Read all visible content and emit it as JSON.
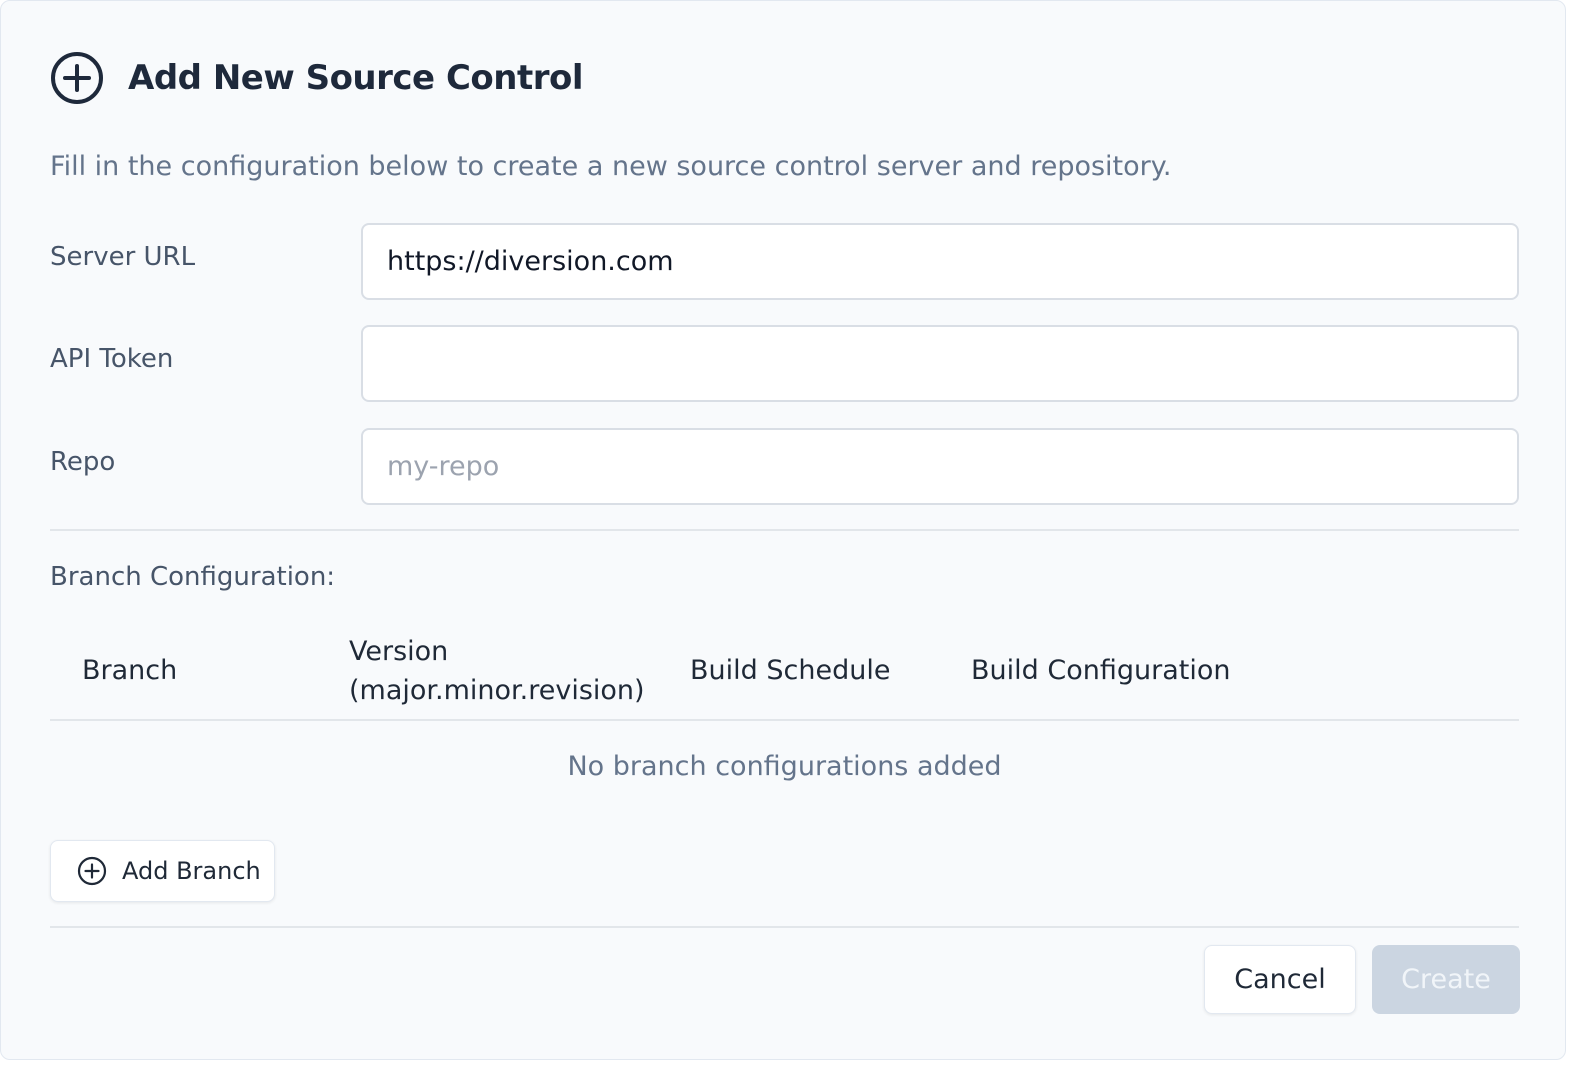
{
  "dialog": {
    "title": "Add New Source Control",
    "title_icon": "plus-circle-icon",
    "subtitle": "Fill in the configuration below to create a new source control server and repository."
  },
  "form": {
    "server_url": {
      "label": "Server URL",
      "value": "https://diversion.com",
      "placeholder": ""
    },
    "api_token": {
      "label": "API Token",
      "value": "",
      "placeholder": ""
    },
    "repo": {
      "label": "Repo",
      "value": "",
      "placeholder": "my-repo"
    }
  },
  "branches": {
    "section_label": "Branch Configuration:",
    "columns": {
      "branch": "Branch",
      "version_line1": "Version",
      "version_line2": "(major.minor.revision)",
      "build_schedule": "Build Schedule",
      "build_configuration": "Build Configuration"
    },
    "empty_message": "No branch configurations added",
    "add_button": {
      "label": "Add Branch",
      "icon": "plus-circle-icon"
    }
  },
  "footer": {
    "cancel_label": "Cancel",
    "create_label": "Create",
    "create_disabled": true
  },
  "colors": {
    "background": "#f8fafc",
    "title": "#1e293b",
    "muted_text": "#64748b",
    "disabled_button": "#cbd5e1"
  }
}
